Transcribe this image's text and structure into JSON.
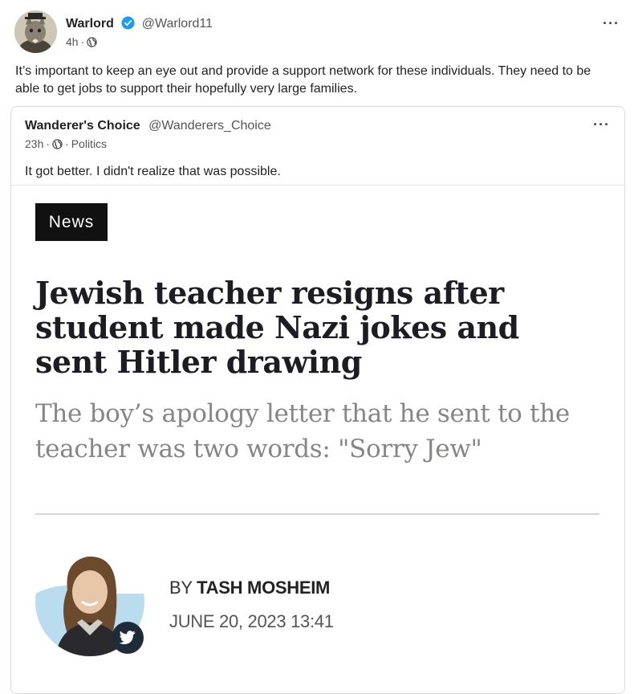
{
  "post": {
    "author_name": "Warlord",
    "author_handle": "@Warlord11",
    "time": "4h",
    "separator": "·",
    "text": "It’s important to keep an eye out and provide a support network for these individuals. They need to be able to get jobs to support their hopefully very large families.",
    "more_label": "···",
    "icons": {
      "verified": "verified-badge-icon",
      "globe": "globe-icon",
      "more": "more-options-icon"
    },
    "verified_color": "#1d9bf0"
  },
  "quote": {
    "author_name": "Wanderer's Choice",
    "author_handle": "@Wanderers_Choice",
    "time": "23h",
    "separator": "·",
    "separator2": "·",
    "category": "Politics",
    "text": "It got better. I didn't realize that was possible.",
    "more_label": "···"
  },
  "article": {
    "tag": "News",
    "headline": "Jewish teacher resigns after student made Nazi jokes and sent Hitler drawing",
    "subheadline": "The boy’s apology letter that he sent to the teacher was two words: \"Sorry Jew\"",
    "byline_prefix": "BY",
    "author": "TASH MOSHEIM",
    "date": "JUNE 20, 2023 13:41",
    "icons": {
      "twitter": "twitter-icon"
    },
    "colors": {
      "tag_bg": "#111111",
      "headline": "#1c1c22",
      "subhead": "#85858a",
      "avatar_bg": "#b9dcef"
    }
  }
}
